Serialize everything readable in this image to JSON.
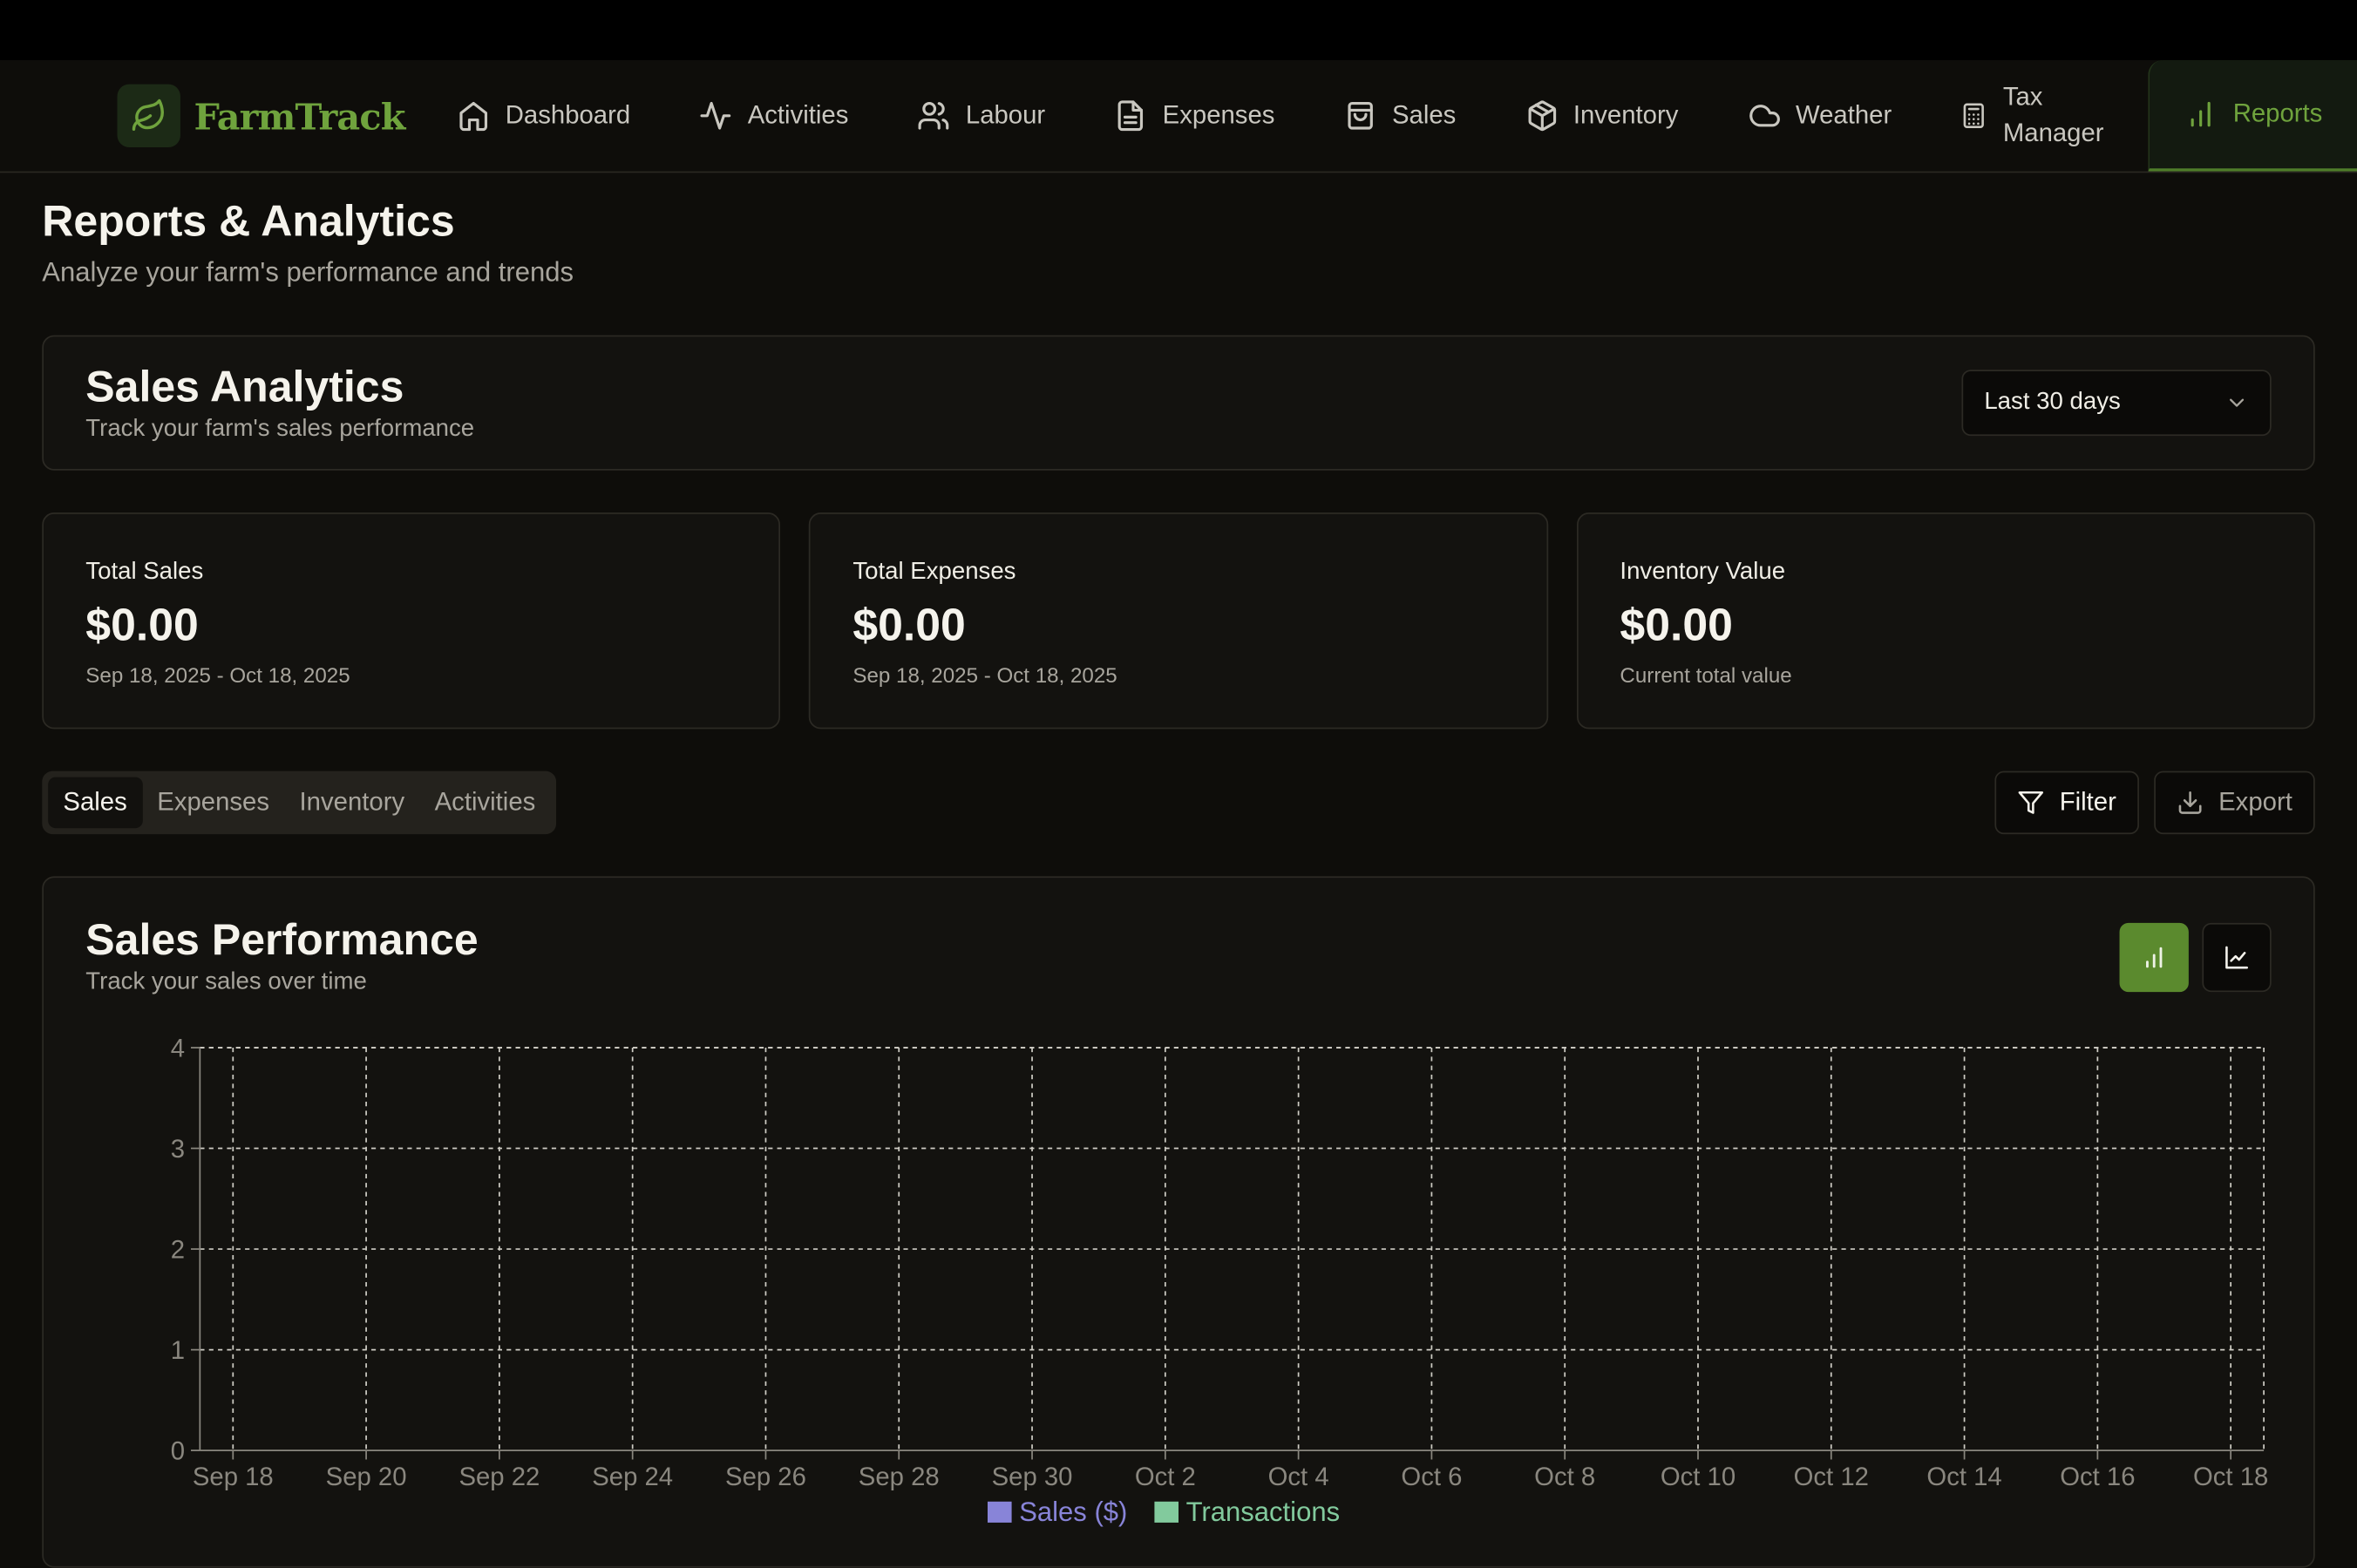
{
  "brand": {
    "name": "FarmTrack",
    "logo_icon": "leaf-icon"
  },
  "nav": [
    {
      "label": "Dashboard",
      "icon": "home-icon"
    },
    {
      "label": "Activities",
      "icon": "activity-icon"
    },
    {
      "label": "Labour",
      "icon": "users-icon"
    },
    {
      "label": "Expenses",
      "icon": "file-icon"
    },
    {
      "label": "Sales",
      "icon": "shopping-bag-icon"
    },
    {
      "label": "Inventory",
      "icon": "package-icon"
    },
    {
      "label": "Weather",
      "icon": "cloud-icon"
    },
    {
      "label": "Tax Manager",
      "icon": "calculator-icon"
    },
    {
      "label": "Reports",
      "icon": "bar-chart-icon",
      "active": true
    }
  ],
  "page": {
    "title": "Reports & Analytics",
    "subtitle": "Analyze your farm's performance and trends"
  },
  "analytics": {
    "title": "Sales Analytics",
    "subtitle": "Track your farm's sales performance",
    "range_select": "Last 30 days"
  },
  "stats": [
    {
      "label": "Total Sales",
      "value": "$0.00",
      "note": "Sep 18, 2025 - Oct 18, 2025"
    },
    {
      "label": "Total Expenses",
      "value": "$0.00",
      "note": "Sep 18, 2025 - Oct 18, 2025"
    },
    {
      "label": "Inventory Value",
      "value": "$0.00",
      "note": "Current total value"
    }
  ],
  "tabs": [
    "Sales",
    "Expenses",
    "Inventory",
    "Activities"
  ],
  "active_tab": "Sales",
  "actions": {
    "filter": "Filter",
    "export": "Export"
  },
  "chart_panel": {
    "title": "Sales Performance",
    "subtitle": "Track your sales over time",
    "view_buttons": [
      "bar-chart-icon",
      "line-chart-icon"
    ],
    "active_view": "bar-chart-icon"
  },
  "colors": {
    "accent": "#5b8a2e",
    "brand": "#6fa33d",
    "sales_series": "#8884d8",
    "transactions_series": "#82ca9d"
  },
  "chart_data": {
    "type": "bar",
    "x_ticks": [
      "Sep 18",
      "Sep 20",
      "Sep 22",
      "Sep 24",
      "Sep 26",
      "Sep 28",
      "Sep 30",
      "Oct 2",
      "Oct 4",
      "Oct 6",
      "Oct 8",
      "Oct 10",
      "Oct 12",
      "Oct 14",
      "Oct 16",
      "Oct 18"
    ],
    "y_ticks": [
      0,
      1,
      2,
      3,
      4
    ],
    "ylim": [
      0,
      4
    ],
    "grid": true,
    "series": [
      {
        "name": "Sales ($)",
        "values": [
          0,
          0,
          0,
          0,
          0,
          0,
          0,
          0,
          0,
          0,
          0,
          0,
          0,
          0,
          0,
          0
        ]
      },
      {
        "name": "Transactions",
        "values": [
          0,
          0,
          0,
          0,
          0,
          0,
          0,
          0,
          0,
          0,
          0,
          0,
          0,
          0,
          0,
          0
        ]
      }
    ],
    "legend": "bottom"
  }
}
